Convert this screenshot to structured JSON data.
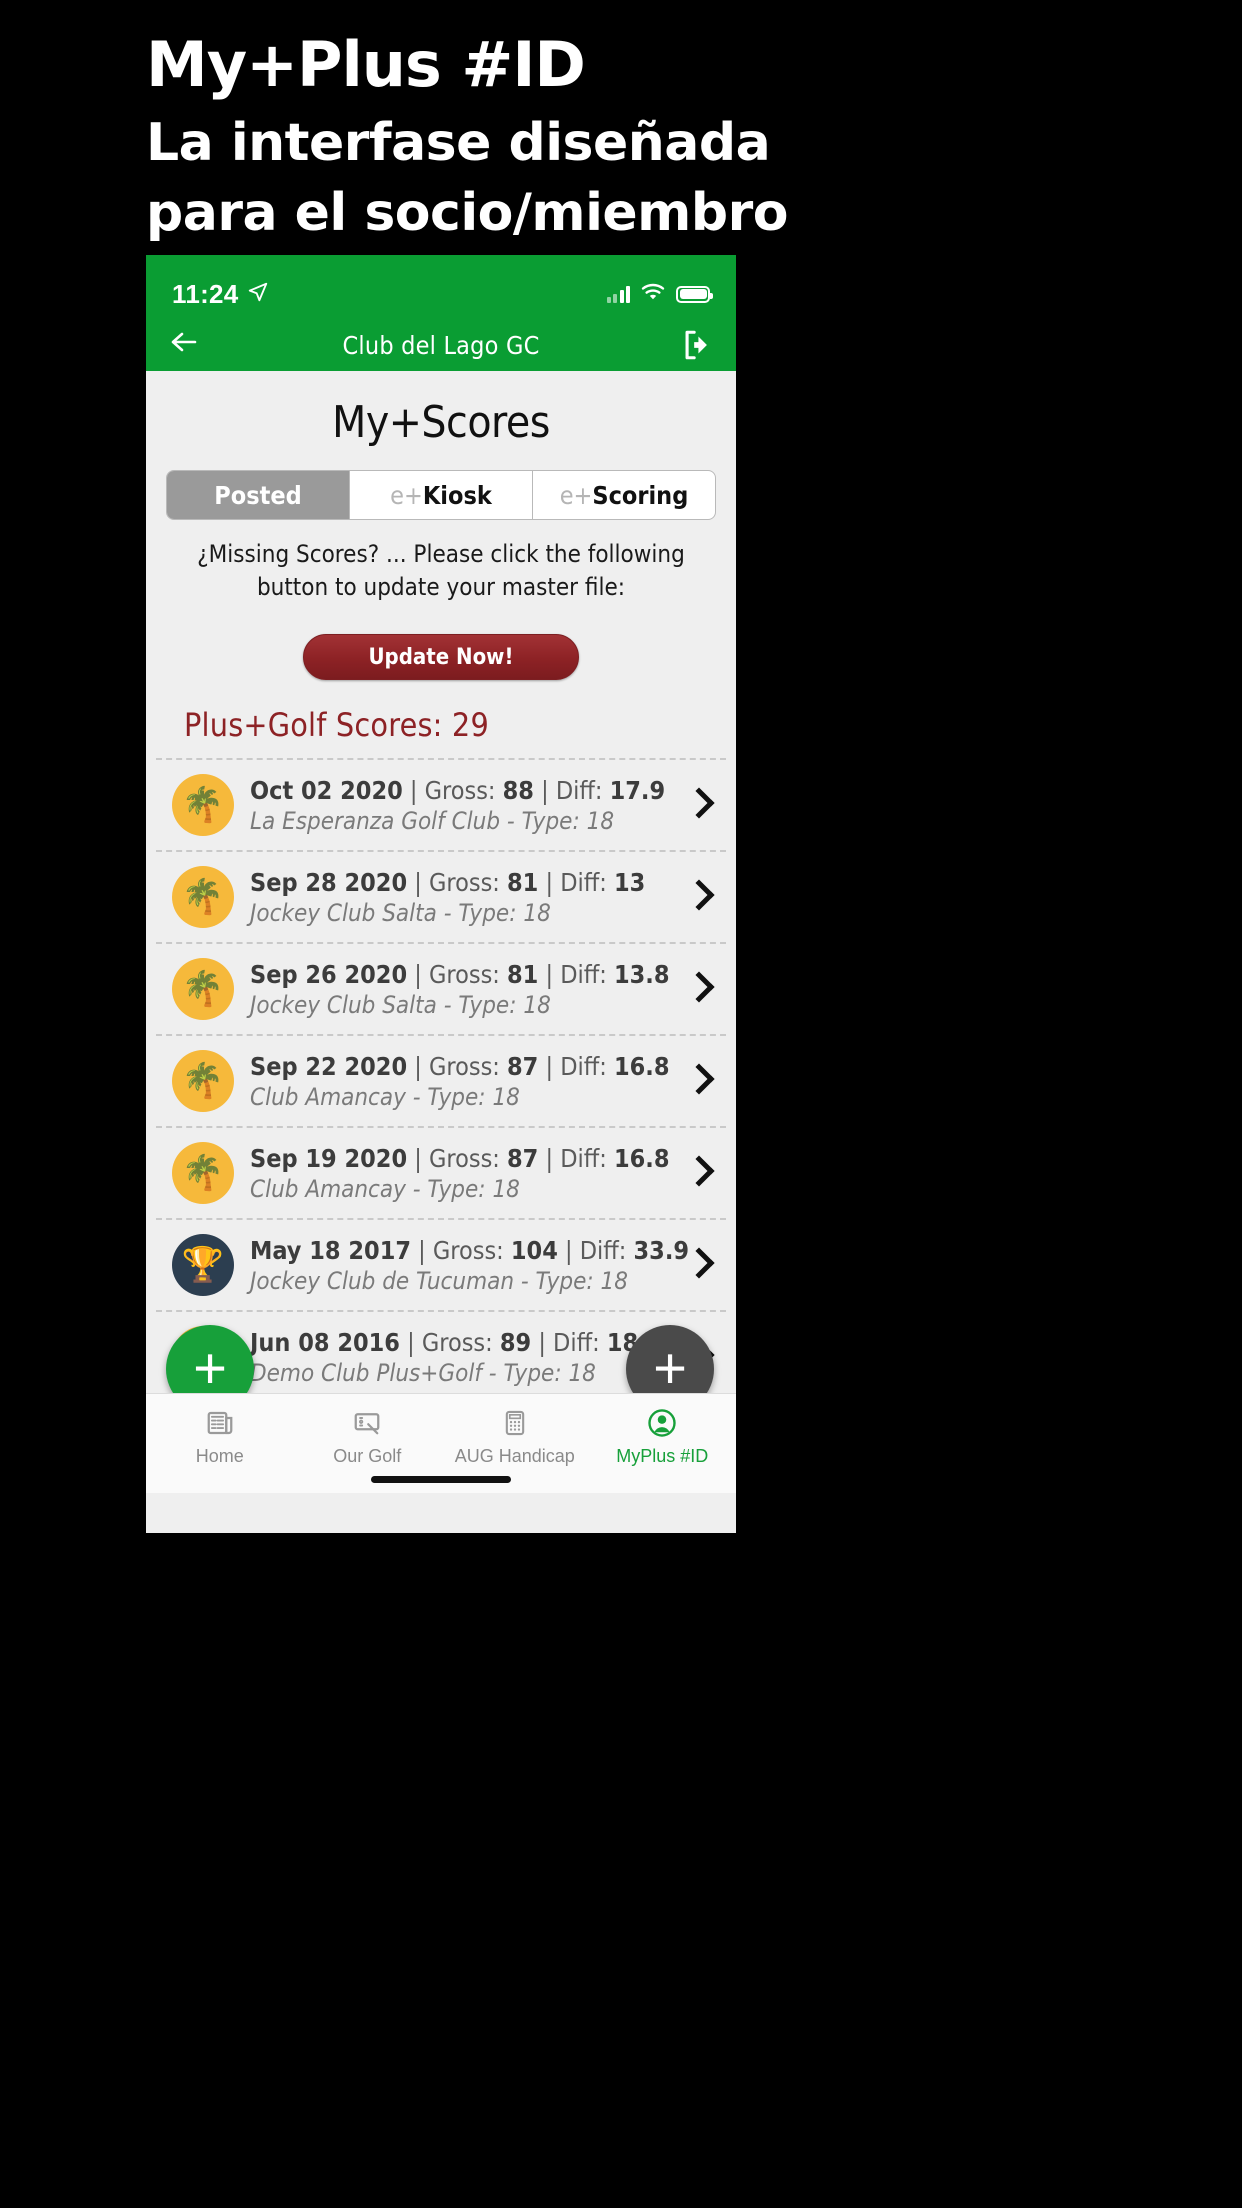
{
  "promo": {
    "title": "My+Plus #ID",
    "subtitle_line1": "La interfase diseñada",
    "subtitle_line2": "para el socio/miembro"
  },
  "statusbar": {
    "time": "11:24",
    "location_icon": "location-arrow-icon",
    "signal_icon": "cellular-signal-icon",
    "wifi_icon": "wifi-icon",
    "battery_icon": "battery-full-icon"
  },
  "navbar": {
    "back_icon": "back-arrow-icon",
    "title": "Club del Lago GC",
    "logout_icon": "logout-icon"
  },
  "main": {
    "page_title": "My+Scores",
    "tabs": [
      {
        "label": "Posted",
        "prefix": "",
        "active": true
      },
      {
        "label": "Kiosk",
        "prefix": "e+",
        "active": false
      },
      {
        "label": "Scoring",
        "prefix": "e+",
        "active": false
      }
    ],
    "hint": "¿Missing Scores? ... Please click the following button to update your master file:",
    "update_button": "Update Now!",
    "scores_header": "Plus+Golf Scores: 29",
    "scores": [
      {
        "icon": "palm-island-icon",
        "glyph": "🌴",
        "line1": "Oct 02 2020 | Gross: 88 | Diff: 17.9",
        "date": "Oct 02 2020",
        "gross": "88",
        "diff": "17.9",
        "line2": "La Esperanza Golf Club - Type: 18",
        "course": "La Esperanza Golf Club",
        "type": "18"
      },
      {
        "icon": "palm-island-icon",
        "glyph": "🌴",
        "line1": "Sep 28 2020 | Gross: 81 | Diff: 13",
        "date": "Sep 28 2020",
        "gross": "81",
        "diff": "13",
        "line2": "Jockey Club Salta - Type: 18",
        "course": "Jockey Club Salta",
        "type": "18"
      },
      {
        "icon": "palm-island-icon",
        "glyph": "🌴",
        "line1": "Sep 26 2020 | Gross: 81 | Diff: 13.8",
        "date": "Sep 26 2020",
        "gross": "81",
        "diff": "13.8",
        "line2": "Jockey Club Salta - Type: 18",
        "course": "Jockey Club Salta",
        "type": "18"
      },
      {
        "icon": "palm-island-icon",
        "glyph": "🌴",
        "line1": "Sep 22 2020 | Gross: 87 | Diff: 16.8",
        "date": "Sep 22 2020",
        "gross": "87",
        "diff": "16.8",
        "line2": "Club Amancay - Type: 18",
        "course": "Club Amancay",
        "type": "18"
      },
      {
        "icon": "palm-island-icon",
        "glyph": "🌴",
        "line1": "Sep 19 2020 | Gross: 87 | Diff: 16.8",
        "date": "Sep 19 2020",
        "gross": "87",
        "diff": "16.8",
        "line2": "Club Amancay - Type: 18",
        "course": "Club Amancay",
        "type": "18"
      },
      {
        "icon": "trophy-icon",
        "glyph": "🏆",
        "line1": "May 18 2017 | Gross: 104 | Diff: 33.9",
        "date": "May 18 2017",
        "gross": "104",
        "diff": "33.9",
        "line2": "Jockey Club de Tucuman - Type: 18",
        "course": "Jockey Club de Tucuman",
        "type": "18"
      },
      {
        "icon": "palm-island-icon",
        "glyph": "🌴",
        "line1": "Jun 08 2016 | Gross: 89 | Diff: 18.2",
        "date": "Jun 08 2016",
        "gross": "89",
        "diff": "18.2",
        "line2": "Demo Club Plus+Golf - Type: 18",
        "course": "Demo Club Plus+Golf",
        "type": "18"
      }
    ],
    "fab_add_primary": "+",
    "fab_add_secondary": "+"
  },
  "tabbar": {
    "items": [
      {
        "label": "Home",
        "icon": "newspaper-icon",
        "active": false
      },
      {
        "label": "Our Golf",
        "icon": "tablet-pen-icon",
        "active": false
      },
      {
        "label": "AUG Handicap",
        "icon": "calculator-icon",
        "active": false
      },
      {
        "label": "MyPlus #ID",
        "icon": "user-circle-icon",
        "active": true
      }
    ]
  },
  "colors": {
    "brand_green": "#0a9d33",
    "accent_red": "#8d2225",
    "segment_active": "#9a9a9a",
    "avatar_amber": "#f6b93b",
    "avatar_navy": "#2c3e50",
    "page_bg": "#efefef"
  }
}
